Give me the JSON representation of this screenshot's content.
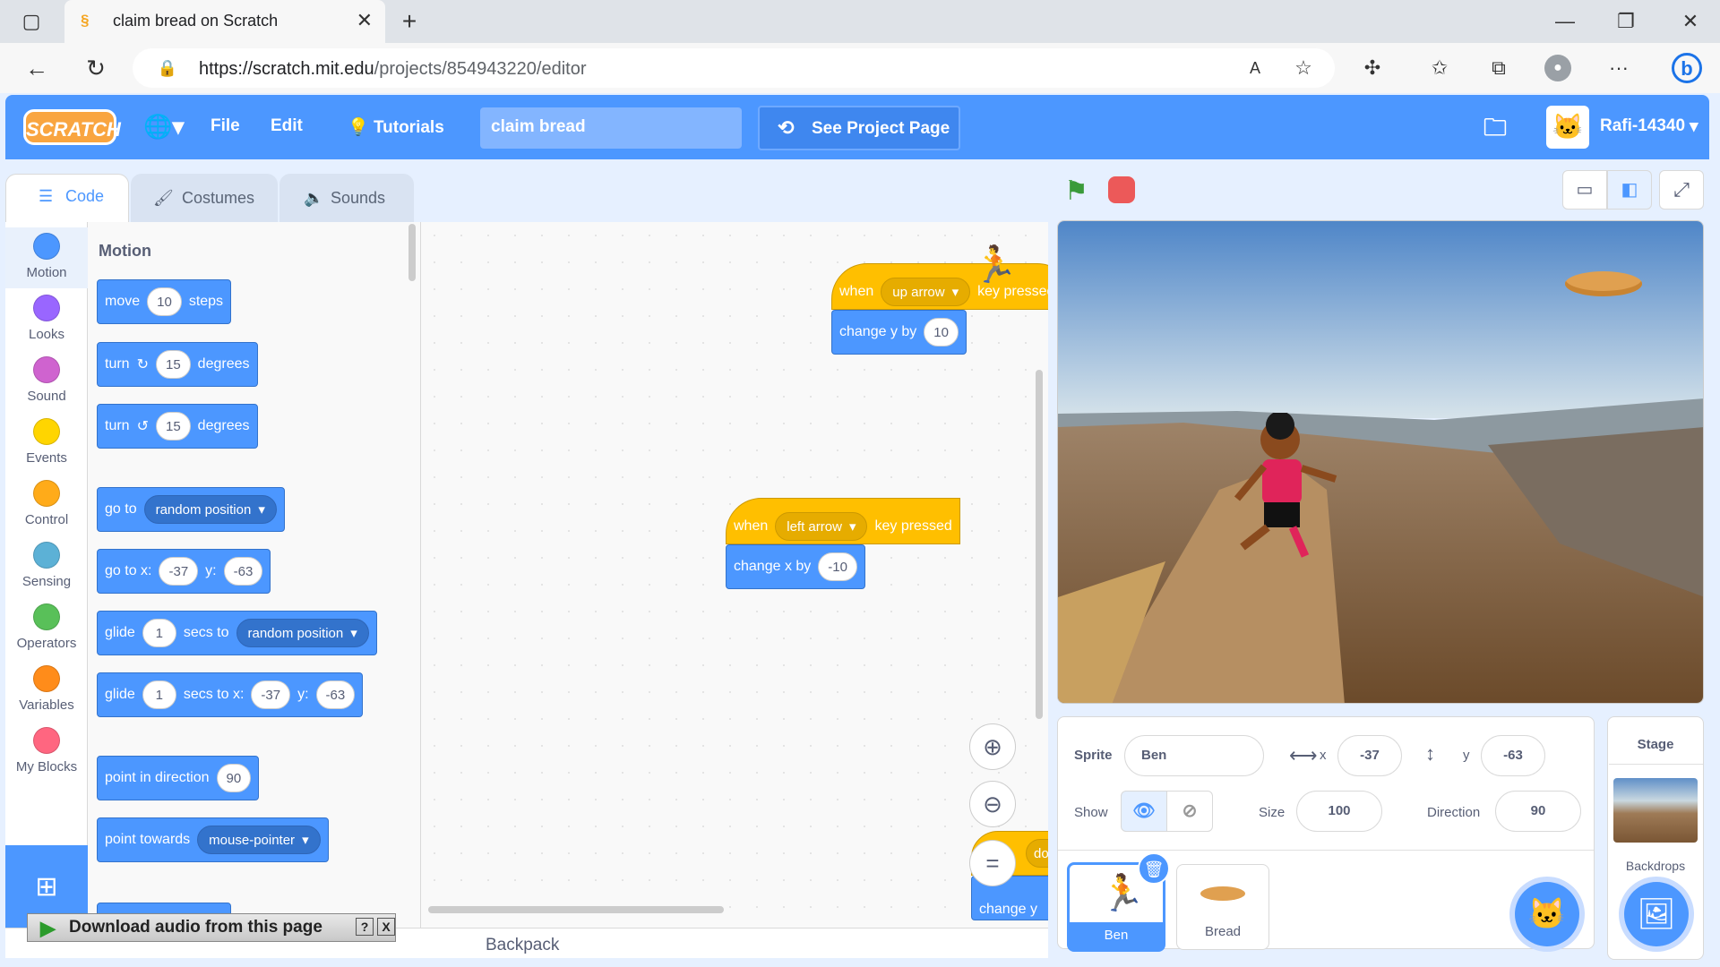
{
  "browser": {
    "tab_title": "claim bread on Scratch",
    "url_host": "https://scratch.mit.edu",
    "url_path": "/projects/854943220/editor"
  },
  "menubar": {
    "logo": "SCRATCH",
    "file": "File",
    "edit": "Edit",
    "tutorials": "Tutorials",
    "project_title": "claim bread",
    "see_project": "See Project Page",
    "username": "Rafi-14340"
  },
  "tabs": {
    "code": "Code",
    "costumes": "Costumes",
    "sounds": "Sounds"
  },
  "categories": [
    {
      "label": "Motion",
      "color": "#4c97ff"
    },
    {
      "label": "Looks",
      "color": "#9966ff"
    },
    {
      "label": "Sound",
      "color": "#cf63cf"
    },
    {
      "label": "Events",
      "color": "#ffd500"
    },
    {
      "label": "Control",
      "color": "#ffab19"
    },
    {
      "label": "Sensing",
      "color": "#5cb1d6"
    },
    {
      "label": "Operators",
      "color": "#59c059"
    },
    {
      "label": "Variables",
      "color": "#ff8c1a"
    },
    {
      "label": "My Blocks",
      "color": "#ff6680"
    }
  ],
  "palette": {
    "heading": "Motion",
    "move": {
      "a": "move",
      "v": "10",
      "b": "steps"
    },
    "turn_cw": {
      "a": "turn",
      "v": "15",
      "b": "degrees"
    },
    "turn_ccw": {
      "a": "turn",
      "v": "15",
      "b": "degrees"
    },
    "goto": {
      "a": "go to",
      "d": "random position"
    },
    "gotoxy": {
      "a": "go to x:",
      "x": "-37",
      "b": "y:",
      "y": "-63"
    },
    "glide": {
      "a": "glide",
      "v": "1",
      "b": "secs to",
      "d": "random position"
    },
    "glidexy": {
      "a": "glide",
      "v": "1",
      "b": "secs to x:",
      "x": "-37",
      "c": "y:",
      "y": "-63"
    },
    "point_dir": {
      "a": "point in direction",
      "v": "90"
    },
    "point_towards": {
      "a": "point towards",
      "d": "mouse-pointer"
    }
  },
  "scripts": [
    {
      "hat_a": "when",
      "key": "up arrow",
      "hat_b": "key pressed",
      "cmd": "change y by",
      "val": "10"
    },
    {
      "hat_a": "when",
      "key": "left arrow",
      "hat_b": "key pressed",
      "cmd": "change x by",
      "val": "-10"
    },
    {
      "partial_hat": "do",
      "partial_cmd": "change y"
    }
  ],
  "backpack": "Backpack",
  "sprite_info": {
    "sprite_label": "Sprite",
    "sprite_name": "Ben",
    "x_label": "x",
    "x": "-37",
    "y_label": "y",
    "y": "-63",
    "show_label": "Show",
    "size_label": "Size",
    "size": "100",
    "direction_label": "Direction",
    "direction": "90"
  },
  "sprites": [
    {
      "name": "Ben"
    },
    {
      "name": "Bread"
    }
  ],
  "stage_panel": {
    "title": "Stage",
    "backdrops": "Backdrops"
  },
  "download_bar": {
    "text": "Download audio from this page",
    "help": "?",
    "close": "X"
  }
}
